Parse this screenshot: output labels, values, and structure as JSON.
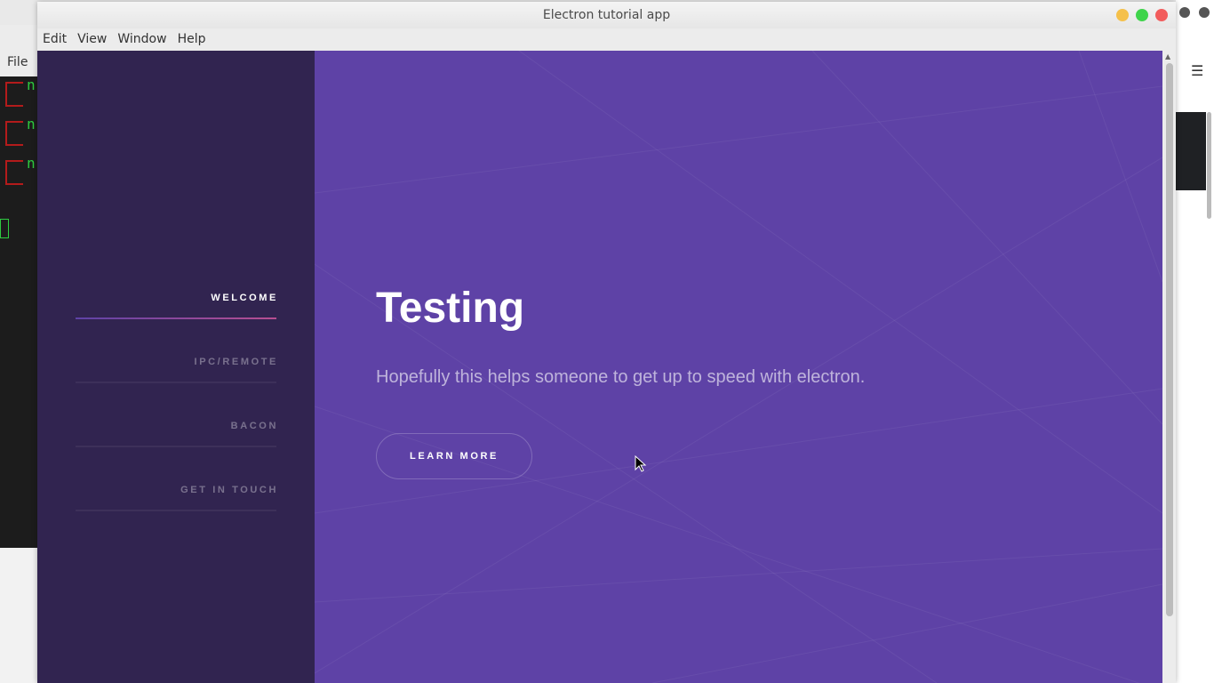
{
  "window": {
    "title": "Electron tutorial app",
    "controls": {
      "minimize_color": "#f5c04a",
      "maximize_color": "#3fd44b",
      "close_color": "#f25c5c"
    }
  },
  "menubar": {
    "items": [
      "Edit",
      "View",
      "Window",
      "Help"
    ]
  },
  "background_apps": {
    "terminal_menu_label": "File",
    "terminal_lines": [
      "n",
      "n",
      "n"
    ]
  },
  "sidebar": {
    "background": "#312450",
    "items": [
      {
        "label": "WELCOME",
        "active": true
      },
      {
        "label": "IPC/REMOTE",
        "active": false
      },
      {
        "label": "BACON",
        "active": false
      },
      {
        "label": "GET IN TOUCH",
        "active": false
      }
    ]
  },
  "hero": {
    "background": "#5e42a6",
    "title": "Testing",
    "subtitle": "Hopefully this helps someone to get up to speed with electron.",
    "button_label": "LEARN MORE"
  }
}
